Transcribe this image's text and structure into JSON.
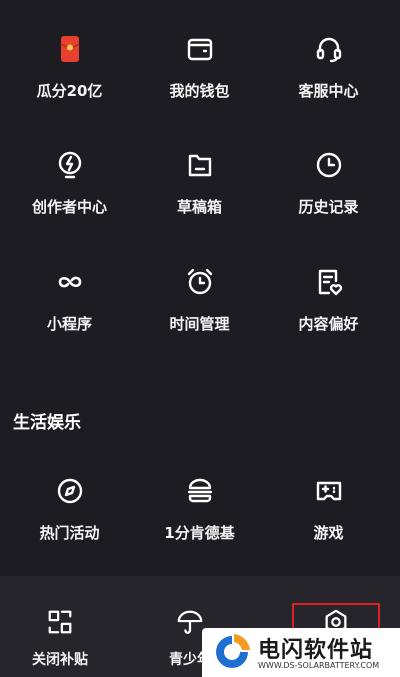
{
  "colors": {
    "background": "#1d1c22",
    "bottom_bar": "#26252b",
    "icon_stroke": "#ffffff",
    "red_packet": "#e8402e",
    "highlight": "#e02020",
    "watermark_blue": "#1f6fd1",
    "watermark_orange": "#f59a23"
  },
  "grid": {
    "row1": [
      {
        "label": "瓜分20亿",
        "icon": "red-packet-icon"
      },
      {
        "label": "我的钱包",
        "icon": "wallet-icon"
      },
      {
        "label": "客服中心",
        "icon": "headset-icon"
      }
    ],
    "row2": [
      {
        "label": "创作者中心",
        "icon": "lightning-bulb-icon"
      },
      {
        "label": "草稿箱",
        "icon": "folder-icon"
      },
      {
        "label": "历史记录",
        "icon": "clock-icon"
      }
    ],
    "row3": [
      {
        "label": "小程序",
        "icon": "infinity-icon"
      },
      {
        "label": "时间管理",
        "icon": "alarm-clock-icon"
      },
      {
        "label": "内容偏好",
        "icon": "document-heart-icon"
      }
    ]
  },
  "section": {
    "title": "生活娱乐",
    "items": [
      {
        "label": "热门活动",
        "icon": "compass-icon"
      },
      {
        "label": "1分肯德基",
        "icon": "burger-icon"
      },
      {
        "label": "游戏",
        "icon": "gamepad-icon"
      }
    ]
  },
  "bottom": {
    "items": [
      {
        "label": "关闭补贴",
        "icon": "scan-frame-icon"
      },
      {
        "label": "青少年",
        "icon": "umbrella-icon"
      },
      {
        "label": "",
        "icon": "settings-hexagon-icon"
      }
    ]
  },
  "watermark": {
    "title": "电闪软件站",
    "url": "WWW.DS-SOLARBATTERY.COM"
  }
}
